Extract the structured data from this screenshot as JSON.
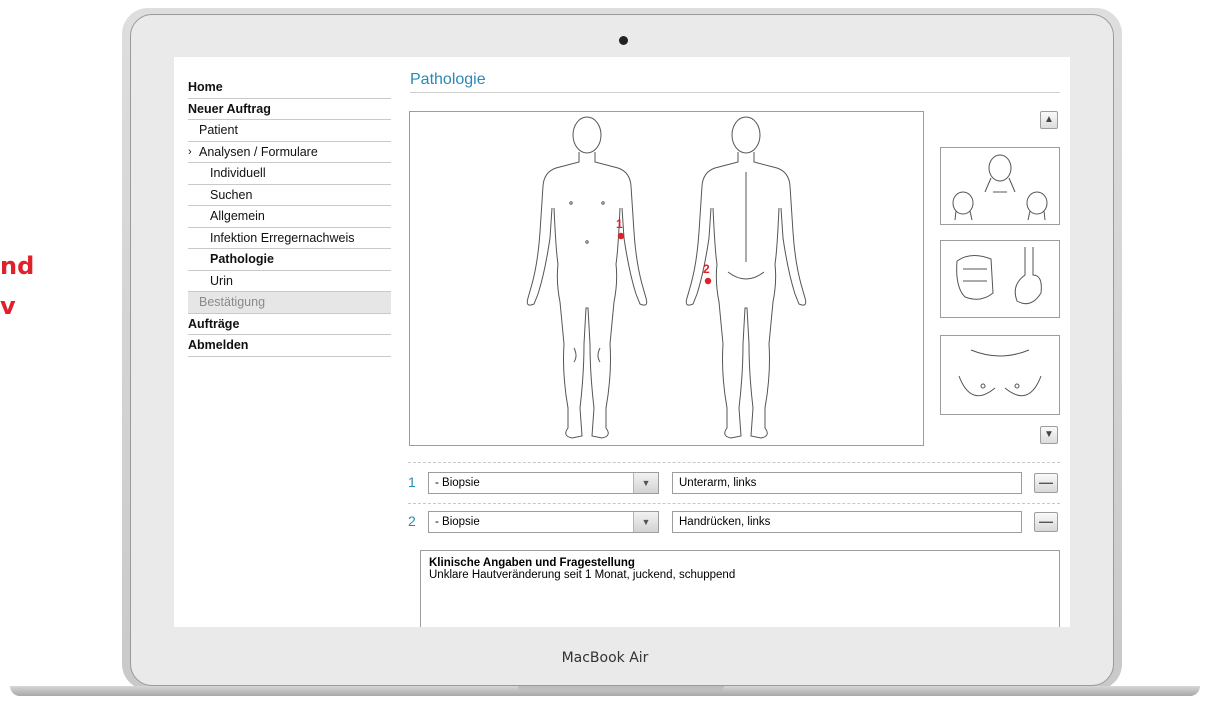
{
  "side_text": [
    "nd",
    "v"
  ],
  "brand": "MacBook Air",
  "nav": [
    {
      "label": "Home",
      "level": 0
    },
    {
      "label": "Neuer Auftrag",
      "level": 0
    },
    {
      "label": "Patient",
      "level": 1
    },
    {
      "label": "Analysen / Formulare",
      "level": 1,
      "expanded": true
    },
    {
      "label": "Individuell",
      "level": 2
    },
    {
      "label": "Suchen",
      "level": 2
    },
    {
      "label": "Allgemein",
      "level": 2
    },
    {
      "label": "Infektion Erregernachweis",
      "level": 2
    },
    {
      "label": "Pathologie",
      "level": 2,
      "current": true
    },
    {
      "label": "Urin",
      "level": 2
    },
    {
      "label": "Bestätigung",
      "level": 1,
      "disabled": true
    },
    {
      "label": "Aufträge",
      "level": 0
    },
    {
      "label": "Abmelden",
      "level": 0
    }
  ],
  "page": {
    "title": "Pathologie"
  },
  "markers": [
    {
      "num": "1",
      "region": "front-left-forearm"
    },
    {
      "num": "2",
      "region": "back-left-hand"
    }
  ],
  "thumbnails": [
    "head-views-icon",
    "digestive-organs-icon",
    "chest-icon"
  ],
  "entries": [
    {
      "num": "1",
      "type": "- Biopsie",
      "location": "Unterarm, links"
    },
    {
      "num": "2",
      "type": "- Biopsie",
      "location": "Handrücken, links"
    }
  ],
  "notes": {
    "heading": "Klinische Angaben und Fragestellung",
    "text": "Unklare Hautveränderung seit 1 Monat, juckend, schuppend"
  },
  "colors": {
    "accent": "#2a8ab7",
    "marker": "#e0202a"
  }
}
